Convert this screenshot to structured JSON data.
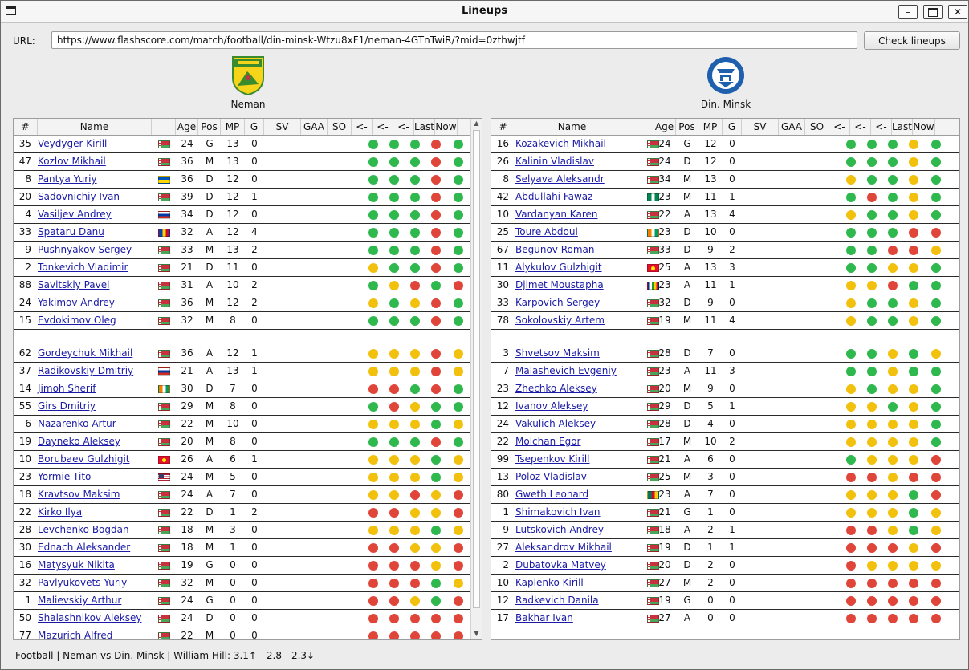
{
  "window": {
    "title": "Lineups"
  },
  "url": {
    "label": "URL:",
    "value": "https://www.flashscore.com/match/football/din-minsk-Wtzu8xF1/neman-4GTnTwiR/?mid=0zthwjtf"
  },
  "check_button": "Check lineups",
  "columns": [
    "#",
    "Name",
    "",
    "Age",
    "Pos",
    "MP",
    "G",
    "SV",
    "GAA",
    "SO",
    "<-",
    "<-",
    "<-",
    "Last",
    "Now"
  ],
  "colors": {
    "g": "#2fb84d",
    "y": "#f2c10e",
    "r": "#e0453a",
    "link": "#1a1aa6"
  },
  "flags": {
    "blr": [
      "#c8313e",
      "#c8313e",
      "#4aa657"
    ],
    "ukr": [
      "#0057b8",
      "#ffd700"
    ],
    "rus": [
      "#ffffff",
      "#0039a6",
      "#d52b1e"
    ],
    "mda": [
      "#0046ae",
      "#ffd200",
      "#cc092f"
    ],
    "civ": [
      "#f77f00",
      "#ffffff",
      "#009e60"
    ],
    "kgz": [
      "#e8112d"
    ],
    "usa": [
      "#b22234",
      "#ffffff",
      "#3c3b6e"
    ],
    "nga": [
      "#008751",
      "#ffffff",
      "#008751"
    ],
    "caf": [
      "#003082",
      "#ffffff",
      "#289728",
      "#ffce00",
      "#d21034"
    ],
    "cmr": [
      "#007a5e",
      "#ce1126",
      "#fcd116"
    ]
  },
  "home": {
    "name": "Neman",
    "logo": "neman-logo",
    "starters": [
      {
        "num": "35",
        "name": "Veydyger Kirill",
        "flag": "blr",
        "age": "24",
        "pos": "G",
        "mp": "13",
        "g": "0",
        "form": [
          "g",
          "g",
          "g",
          "r",
          "g"
        ]
      },
      {
        "num": "47",
        "name": "Kozlov Mikhail",
        "flag": "blr",
        "age": "36",
        "pos": "M",
        "mp": "13",
        "g": "0",
        "form": [
          "g",
          "g",
          "g",
          "r",
          "g"
        ]
      },
      {
        "num": "8",
        "name": "Pantya Yuriy",
        "flag": "ukr",
        "age": "36",
        "pos": "D",
        "mp": "12",
        "g": "0",
        "form": [
          "g",
          "g",
          "g",
          "r",
          "g"
        ]
      },
      {
        "num": "20",
        "name": "Sadovnichiy Ivan",
        "flag": "blr",
        "age": "39",
        "pos": "D",
        "mp": "12",
        "g": "1",
        "form": [
          "g",
          "g",
          "g",
          "r",
          "g"
        ]
      },
      {
        "num": "4",
        "name": "Vasiljev Andrey",
        "flag": "rus",
        "age": "34",
        "pos": "D",
        "mp": "12",
        "g": "0",
        "form": [
          "g",
          "g",
          "g",
          "r",
          "g"
        ]
      },
      {
        "num": "33",
        "name": "Spataru Danu",
        "flag": "mda",
        "age": "32",
        "pos": "A",
        "mp": "12",
        "g": "4",
        "form": [
          "g",
          "g",
          "g",
          "r",
          "g"
        ]
      },
      {
        "num": "9",
        "name": "Pushnyakov Sergey",
        "flag": "blr",
        "age": "33",
        "pos": "M",
        "mp": "13",
        "g": "2",
        "form": [
          "g",
          "g",
          "g",
          "r",
          "g"
        ]
      },
      {
        "num": "2",
        "name": "Tonkevich Vladimir",
        "flag": "blr",
        "age": "21",
        "pos": "D",
        "mp": "11",
        "g": "0",
        "form": [
          "y",
          "g",
          "g",
          "r",
          "g"
        ]
      },
      {
        "num": "88",
        "name": "Savitskiy Pavel",
        "flag": "blr",
        "age": "31",
        "pos": "A",
        "mp": "10",
        "g": "2",
        "form": [
          "g",
          "y",
          "r",
          "g",
          "r"
        ]
      },
      {
        "num": "24",
        "name": "Yakimov Andrey",
        "flag": "blr",
        "age": "36",
        "pos": "M",
        "mp": "12",
        "g": "2",
        "form": [
          "y",
          "g",
          "y",
          "r",
          "g"
        ]
      },
      {
        "num": "15",
        "name": "Evdokimov Oleg",
        "flag": "blr",
        "age": "32",
        "pos": "M",
        "mp": "8",
        "g": "0",
        "form": [
          "g",
          "g",
          "g",
          "r",
          "g"
        ]
      }
    ],
    "subs": [
      {
        "num": "62",
        "name": "Gordeychuk Mikhail",
        "flag": "blr",
        "age": "36",
        "pos": "A",
        "mp": "12",
        "g": "1",
        "form": [
          "y",
          "y",
          "y",
          "r",
          "y"
        ]
      },
      {
        "num": "37",
        "name": "Radikovskiy Dmitriy",
        "flag": "rus",
        "age": "21",
        "pos": "A",
        "mp": "13",
        "g": "1",
        "form": [
          "y",
          "y",
          "y",
          "r",
          "y"
        ]
      },
      {
        "num": "14",
        "name": "Jimoh Sherif",
        "flag": "civ",
        "age": "30",
        "pos": "D",
        "mp": "7",
        "g": "0",
        "form": [
          "r",
          "r",
          "g",
          "r",
          "g"
        ]
      },
      {
        "num": "55",
        "name": "Girs Dmitriy",
        "flag": "blr",
        "age": "29",
        "pos": "M",
        "mp": "8",
        "g": "0",
        "form": [
          "g",
          "r",
          "y",
          "g",
          "g"
        ]
      },
      {
        "num": "6",
        "name": "Nazarenko Artur",
        "flag": "blr",
        "age": "22",
        "pos": "M",
        "mp": "10",
        "g": "0",
        "form": [
          "y",
          "y",
          "y",
          "g",
          "y"
        ]
      },
      {
        "num": "19",
        "name": "Dayneko Aleksey",
        "flag": "blr",
        "age": "20",
        "pos": "M",
        "mp": "8",
        "g": "0",
        "form": [
          "g",
          "g",
          "g",
          "r",
          "g"
        ]
      },
      {
        "num": "10",
        "name": "Borubaev Gulzhigit",
        "flag": "kgz",
        "age": "26",
        "pos": "A",
        "mp": "6",
        "g": "1",
        "form": [
          "y",
          "y",
          "y",
          "g",
          "y"
        ]
      },
      {
        "num": "23",
        "name": "Yormie Tito",
        "flag": "usa",
        "age": "24",
        "pos": "M",
        "mp": "5",
        "g": "0",
        "form": [
          "y",
          "y",
          "y",
          "g",
          "y"
        ]
      },
      {
        "num": "18",
        "name": "Kravtsov Maksim",
        "flag": "blr",
        "age": "24",
        "pos": "A",
        "mp": "7",
        "g": "0",
        "form": [
          "y",
          "y",
          "r",
          "y",
          "r"
        ]
      },
      {
        "num": "22",
        "name": "Kirko Ilya",
        "flag": "blr",
        "age": "22",
        "pos": "D",
        "mp": "1",
        "g": "2",
        "form": [
          "r",
          "r",
          "y",
          "y",
          "r"
        ]
      },
      {
        "num": "28",
        "name": "Levchenko Bogdan",
        "flag": "blr",
        "age": "18",
        "pos": "M",
        "mp": "3",
        "g": "0",
        "form": [
          "y",
          "y",
          "y",
          "g",
          "y"
        ]
      },
      {
        "num": "30",
        "name": "Ednach Aleksander",
        "flag": "blr",
        "age": "18",
        "pos": "M",
        "mp": "1",
        "g": "0",
        "form": [
          "r",
          "r",
          "y",
          "y",
          "r"
        ]
      },
      {
        "num": "16",
        "name": "Matysyuk Nikita",
        "flag": "blr",
        "age": "19",
        "pos": "G",
        "mp": "0",
        "g": "0",
        "form": [
          "r",
          "r",
          "r",
          "y",
          "r"
        ]
      },
      {
        "num": "32",
        "name": "Pavlyukovets Yuriy",
        "flag": "blr",
        "age": "32",
        "pos": "M",
        "mp": "0",
        "g": "0",
        "form": [
          "r",
          "r",
          "r",
          "g",
          "y"
        ]
      },
      {
        "num": "1",
        "name": "Malievskiy Arthur",
        "flag": "blr",
        "age": "24",
        "pos": "G",
        "mp": "0",
        "g": "0",
        "form": [
          "r",
          "r",
          "y",
          "g",
          "r"
        ]
      },
      {
        "num": "50",
        "name": "Shalashnikov Aleksey",
        "flag": "blr",
        "age": "24",
        "pos": "D",
        "mp": "0",
        "g": "0",
        "form": [
          "r",
          "r",
          "r",
          "r",
          "r"
        ]
      },
      {
        "num": "77",
        "name": "Mazurich Alfred",
        "flag": "blr",
        "age": "22",
        "pos": "M",
        "mp": "0",
        "g": "0",
        "form": [
          "r",
          "r",
          "r",
          "r",
          "r"
        ]
      }
    ]
  },
  "away": {
    "name": "Din. Minsk",
    "logo": "dinamo-minsk-logo",
    "starters": [
      {
        "num": "16",
        "name": "Kozakevich Mikhail",
        "flag": "blr",
        "age": "24",
        "pos": "G",
        "mp": "12",
        "g": "0",
        "form": [
          "g",
          "g",
          "g",
          "y",
          "g"
        ]
      },
      {
        "num": "26",
        "name": "Kalinin Vladislav",
        "flag": "blr",
        "age": "24",
        "pos": "D",
        "mp": "12",
        "g": "0",
        "form": [
          "g",
          "g",
          "g",
          "y",
          "g"
        ]
      },
      {
        "num": "8",
        "name": "Selyava Aleksandr",
        "flag": "blr",
        "age": "34",
        "pos": "M",
        "mp": "13",
        "g": "0",
        "form": [
          "y",
          "g",
          "g",
          "y",
          "g"
        ]
      },
      {
        "num": "42",
        "name": "Abdullahi Fawaz",
        "flag": "nga",
        "age": "23",
        "pos": "M",
        "mp": "11",
        "g": "1",
        "form": [
          "g",
          "r",
          "g",
          "y",
          "g"
        ]
      },
      {
        "num": "10",
        "name": "Vardanyan Karen",
        "flag": "blr",
        "age": "22",
        "pos": "A",
        "mp": "13",
        "g": "4",
        "form": [
          "y",
          "g",
          "g",
          "y",
          "g"
        ]
      },
      {
        "num": "25",
        "name": "Toure Abdoul",
        "flag": "civ",
        "age": "23",
        "pos": "D",
        "mp": "10",
        "g": "0",
        "form": [
          "g",
          "g",
          "g",
          "r",
          "r"
        ]
      },
      {
        "num": "67",
        "name": "Begunov Roman",
        "flag": "blr",
        "age": "33",
        "pos": "D",
        "mp": "9",
        "g": "2",
        "form": [
          "g",
          "g",
          "r",
          "r",
          "y"
        ]
      },
      {
        "num": "11",
        "name": "Alykulov Gulzhigit",
        "flag": "kgz",
        "age": "25",
        "pos": "A",
        "mp": "13",
        "g": "3",
        "form": [
          "g",
          "g",
          "y",
          "y",
          "g"
        ]
      },
      {
        "num": "30",
        "name": "Djimet Moustapha",
        "flag": "caf",
        "age": "23",
        "pos": "A",
        "mp": "11",
        "g": "1",
        "form": [
          "y",
          "y",
          "r",
          "g",
          "g"
        ]
      },
      {
        "num": "33",
        "name": "Karpovich Sergey",
        "flag": "blr",
        "age": "32",
        "pos": "D",
        "mp": "9",
        "g": "0",
        "form": [
          "y",
          "g",
          "g",
          "y",
          "g"
        ]
      },
      {
        "num": "78",
        "name": "Sokolovskiy Artem",
        "flag": "blr",
        "age": "19",
        "pos": "M",
        "mp": "11",
        "g": "4",
        "form": [
          "y",
          "g",
          "g",
          "y",
          "g"
        ]
      }
    ],
    "subs": [
      {
        "num": "3",
        "name": "Shvetsov Maksim",
        "flag": "blr",
        "age": "28",
        "pos": "D",
        "mp": "7",
        "g": "0",
        "form": [
          "g",
          "g",
          "y",
          "g",
          "y"
        ]
      },
      {
        "num": "7",
        "name": "Malashevich Evgeniy",
        "flag": "blr",
        "age": "23",
        "pos": "A",
        "mp": "11",
        "g": "3",
        "form": [
          "g",
          "g",
          "y",
          "g",
          "g"
        ]
      },
      {
        "num": "23",
        "name": "Zhechko Aleksey",
        "flag": "blr",
        "age": "20",
        "pos": "M",
        "mp": "9",
        "g": "0",
        "form": [
          "y",
          "g",
          "y",
          "y",
          "g"
        ]
      },
      {
        "num": "12",
        "name": "Ivanov Aleksey",
        "flag": "blr",
        "age": "29",
        "pos": "D",
        "mp": "5",
        "g": "1",
        "form": [
          "y",
          "y",
          "g",
          "y",
          "g"
        ]
      },
      {
        "num": "24",
        "name": "Vakulich Aleksey",
        "flag": "blr",
        "age": "28",
        "pos": "D",
        "mp": "4",
        "g": "0",
        "form": [
          "y",
          "y",
          "y",
          "y",
          "g"
        ]
      },
      {
        "num": "22",
        "name": "Molchan Egor",
        "flag": "blr",
        "age": "17",
        "pos": "M",
        "mp": "10",
        "g": "2",
        "form": [
          "y",
          "y",
          "y",
          "y",
          "g"
        ]
      },
      {
        "num": "99",
        "name": "Tsepenkov Kirill",
        "flag": "blr",
        "age": "21",
        "pos": "A",
        "mp": "6",
        "g": "0",
        "form": [
          "g",
          "y",
          "y",
          "y",
          "r"
        ]
      },
      {
        "num": "13",
        "name": "Poloz Vladislav",
        "flag": "blr",
        "age": "25",
        "pos": "M",
        "mp": "3",
        "g": "0",
        "form": [
          "r",
          "r",
          "y",
          "r",
          "r"
        ]
      },
      {
        "num": "80",
        "name": "Gweth Leonard",
        "flag": "cmr",
        "age": "23",
        "pos": "A",
        "mp": "7",
        "g": "0",
        "form": [
          "y",
          "y",
          "y",
          "g",
          "r"
        ]
      },
      {
        "num": "1",
        "name": "Shimakovich Ivan",
        "flag": "blr",
        "age": "21",
        "pos": "G",
        "mp": "1",
        "g": "0",
        "form": [
          "y",
          "y",
          "y",
          "g",
          "y"
        ]
      },
      {
        "num": "9",
        "name": "Lutskovich Andrey",
        "flag": "blr",
        "age": "18",
        "pos": "A",
        "mp": "2",
        "g": "1",
        "form": [
          "r",
          "r",
          "y",
          "g",
          "y"
        ]
      },
      {
        "num": "27",
        "name": "Aleksandrov Mikhail",
        "flag": "blr",
        "age": "19",
        "pos": "D",
        "mp": "1",
        "g": "1",
        "form": [
          "r",
          "r",
          "r",
          "y",
          "r"
        ]
      },
      {
        "num": "2",
        "name": "Dubatovka Matvey",
        "flag": "blr",
        "age": "20",
        "pos": "D",
        "mp": "2",
        "g": "0",
        "form": [
          "r",
          "y",
          "y",
          "y",
          "y"
        ]
      },
      {
        "num": "10",
        "name": "Kaplenko Kirill",
        "flag": "blr",
        "age": "27",
        "pos": "M",
        "mp": "2",
        "g": "0",
        "form": [
          "r",
          "r",
          "r",
          "r",
          "r"
        ]
      },
      {
        "num": "12",
        "name": "Radkevich Danila",
        "flag": "blr",
        "age": "19",
        "pos": "G",
        "mp": "0",
        "g": "0",
        "form": [
          "r",
          "r",
          "r",
          "r",
          "r"
        ]
      },
      {
        "num": "17",
        "name": "Bakhar Ivan",
        "flag": "blr",
        "age": "27",
        "pos": "A",
        "mp": "0",
        "g": "0",
        "form": [
          "r",
          "r",
          "r",
          "r",
          "r"
        ]
      }
    ]
  },
  "status": "Football | Neman  vs  Din. Minsk  |  William Hill: 3.1↑ - 2.8 - 2.3↓"
}
